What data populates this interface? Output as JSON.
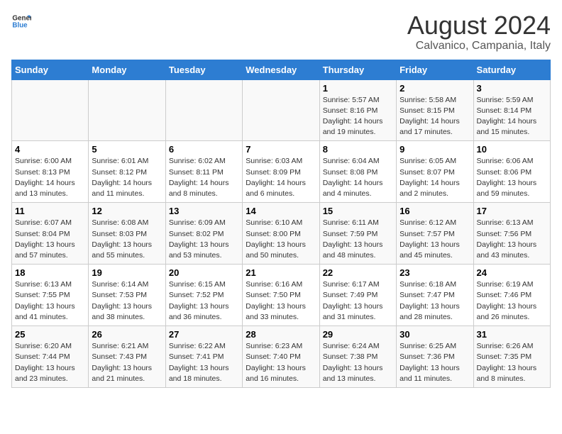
{
  "header": {
    "logo_general": "General",
    "logo_blue": "Blue",
    "month_year": "August 2024",
    "location": "Calvanico, Campania, Italy"
  },
  "days_of_week": [
    "Sunday",
    "Monday",
    "Tuesday",
    "Wednesday",
    "Thursday",
    "Friday",
    "Saturday"
  ],
  "weeks": [
    [
      {
        "day": "",
        "info": ""
      },
      {
        "day": "",
        "info": ""
      },
      {
        "day": "",
        "info": ""
      },
      {
        "day": "",
        "info": ""
      },
      {
        "day": "1",
        "info": "Sunrise: 5:57 AM\nSunset: 8:16 PM\nDaylight: 14 hours\nand 19 minutes."
      },
      {
        "day": "2",
        "info": "Sunrise: 5:58 AM\nSunset: 8:15 PM\nDaylight: 14 hours\nand 17 minutes."
      },
      {
        "day": "3",
        "info": "Sunrise: 5:59 AM\nSunset: 8:14 PM\nDaylight: 14 hours\nand 15 minutes."
      }
    ],
    [
      {
        "day": "4",
        "info": "Sunrise: 6:00 AM\nSunset: 8:13 PM\nDaylight: 14 hours\nand 13 minutes."
      },
      {
        "day": "5",
        "info": "Sunrise: 6:01 AM\nSunset: 8:12 PM\nDaylight: 14 hours\nand 11 minutes."
      },
      {
        "day": "6",
        "info": "Sunrise: 6:02 AM\nSunset: 8:11 PM\nDaylight: 14 hours\nand 8 minutes."
      },
      {
        "day": "7",
        "info": "Sunrise: 6:03 AM\nSunset: 8:09 PM\nDaylight: 14 hours\nand 6 minutes."
      },
      {
        "day": "8",
        "info": "Sunrise: 6:04 AM\nSunset: 8:08 PM\nDaylight: 14 hours\nand 4 minutes."
      },
      {
        "day": "9",
        "info": "Sunrise: 6:05 AM\nSunset: 8:07 PM\nDaylight: 14 hours\nand 2 minutes."
      },
      {
        "day": "10",
        "info": "Sunrise: 6:06 AM\nSunset: 8:06 PM\nDaylight: 13 hours\nand 59 minutes."
      }
    ],
    [
      {
        "day": "11",
        "info": "Sunrise: 6:07 AM\nSunset: 8:04 PM\nDaylight: 13 hours\nand 57 minutes."
      },
      {
        "day": "12",
        "info": "Sunrise: 6:08 AM\nSunset: 8:03 PM\nDaylight: 13 hours\nand 55 minutes."
      },
      {
        "day": "13",
        "info": "Sunrise: 6:09 AM\nSunset: 8:02 PM\nDaylight: 13 hours\nand 53 minutes."
      },
      {
        "day": "14",
        "info": "Sunrise: 6:10 AM\nSunset: 8:00 PM\nDaylight: 13 hours\nand 50 minutes."
      },
      {
        "day": "15",
        "info": "Sunrise: 6:11 AM\nSunset: 7:59 PM\nDaylight: 13 hours\nand 48 minutes."
      },
      {
        "day": "16",
        "info": "Sunrise: 6:12 AM\nSunset: 7:57 PM\nDaylight: 13 hours\nand 45 minutes."
      },
      {
        "day": "17",
        "info": "Sunrise: 6:13 AM\nSunset: 7:56 PM\nDaylight: 13 hours\nand 43 minutes."
      }
    ],
    [
      {
        "day": "18",
        "info": "Sunrise: 6:13 AM\nSunset: 7:55 PM\nDaylight: 13 hours\nand 41 minutes."
      },
      {
        "day": "19",
        "info": "Sunrise: 6:14 AM\nSunset: 7:53 PM\nDaylight: 13 hours\nand 38 minutes."
      },
      {
        "day": "20",
        "info": "Sunrise: 6:15 AM\nSunset: 7:52 PM\nDaylight: 13 hours\nand 36 minutes."
      },
      {
        "day": "21",
        "info": "Sunrise: 6:16 AM\nSunset: 7:50 PM\nDaylight: 13 hours\nand 33 minutes."
      },
      {
        "day": "22",
        "info": "Sunrise: 6:17 AM\nSunset: 7:49 PM\nDaylight: 13 hours\nand 31 minutes."
      },
      {
        "day": "23",
        "info": "Sunrise: 6:18 AM\nSunset: 7:47 PM\nDaylight: 13 hours\nand 28 minutes."
      },
      {
        "day": "24",
        "info": "Sunrise: 6:19 AM\nSunset: 7:46 PM\nDaylight: 13 hours\nand 26 minutes."
      }
    ],
    [
      {
        "day": "25",
        "info": "Sunrise: 6:20 AM\nSunset: 7:44 PM\nDaylight: 13 hours\nand 23 minutes."
      },
      {
        "day": "26",
        "info": "Sunrise: 6:21 AM\nSunset: 7:43 PM\nDaylight: 13 hours\nand 21 minutes."
      },
      {
        "day": "27",
        "info": "Sunrise: 6:22 AM\nSunset: 7:41 PM\nDaylight: 13 hours\nand 18 minutes."
      },
      {
        "day": "28",
        "info": "Sunrise: 6:23 AM\nSunset: 7:40 PM\nDaylight: 13 hours\nand 16 minutes."
      },
      {
        "day": "29",
        "info": "Sunrise: 6:24 AM\nSunset: 7:38 PM\nDaylight: 13 hours\nand 13 minutes."
      },
      {
        "day": "30",
        "info": "Sunrise: 6:25 AM\nSunset: 7:36 PM\nDaylight: 13 hours\nand 11 minutes."
      },
      {
        "day": "31",
        "info": "Sunrise: 6:26 AM\nSunset: 7:35 PM\nDaylight: 13 hours\nand 8 minutes."
      }
    ]
  ]
}
